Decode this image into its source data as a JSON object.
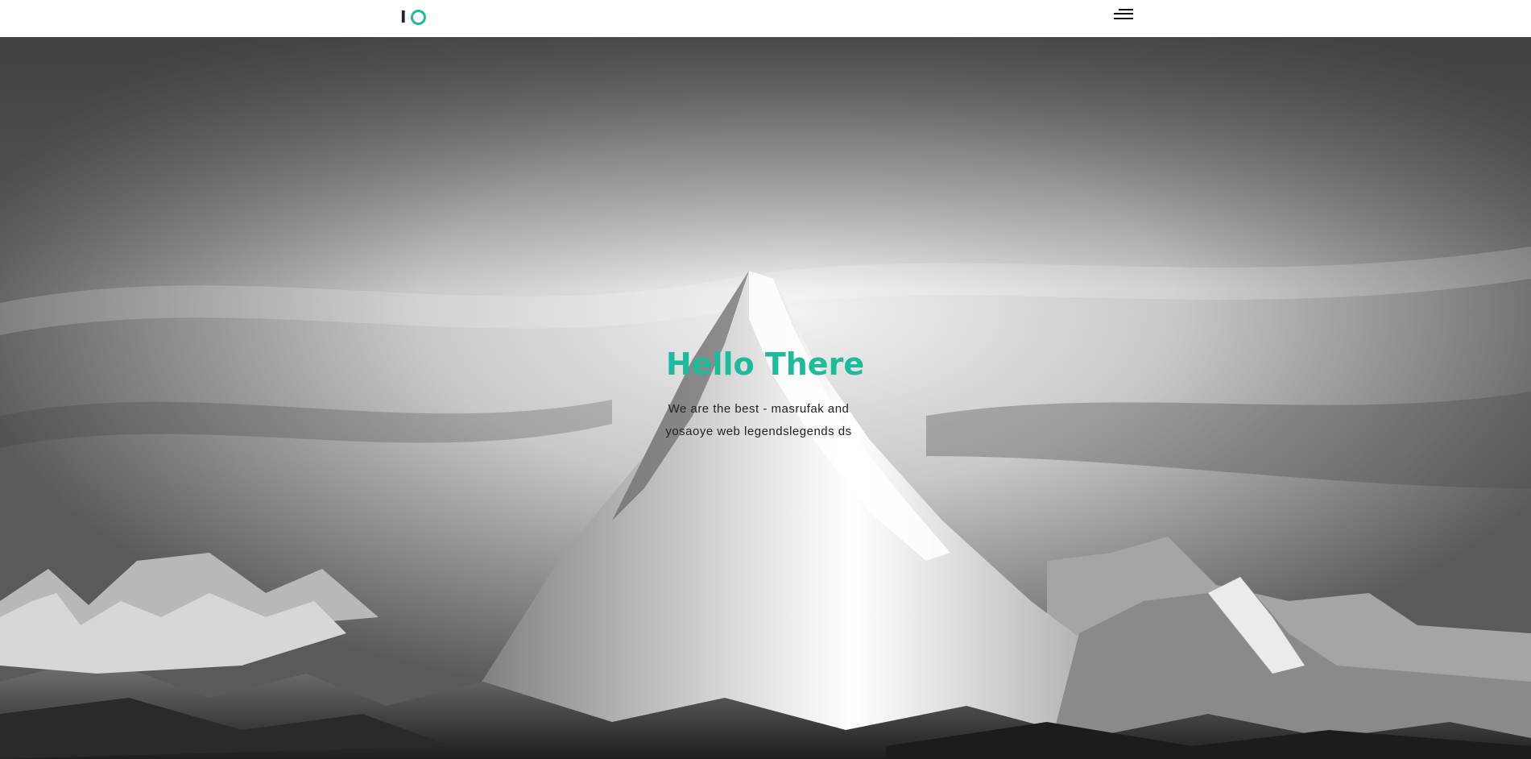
{
  "header": {
    "logo_letter": "I",
    "logo_ring": "O",
    "menu_icon": "hamburger-menu-icon"
  },
  "hero": {
    "title": "Hello There",
    "subtitle": "We are the best - masrufak and yosaoye web legendslegends ds",
    "background": "mountain-photo"
  },
  "colors": {
    "accent": "#1abc9c",
    "text_dark": "#222222",
    "header_bg": "#ffffff"
  }
}
